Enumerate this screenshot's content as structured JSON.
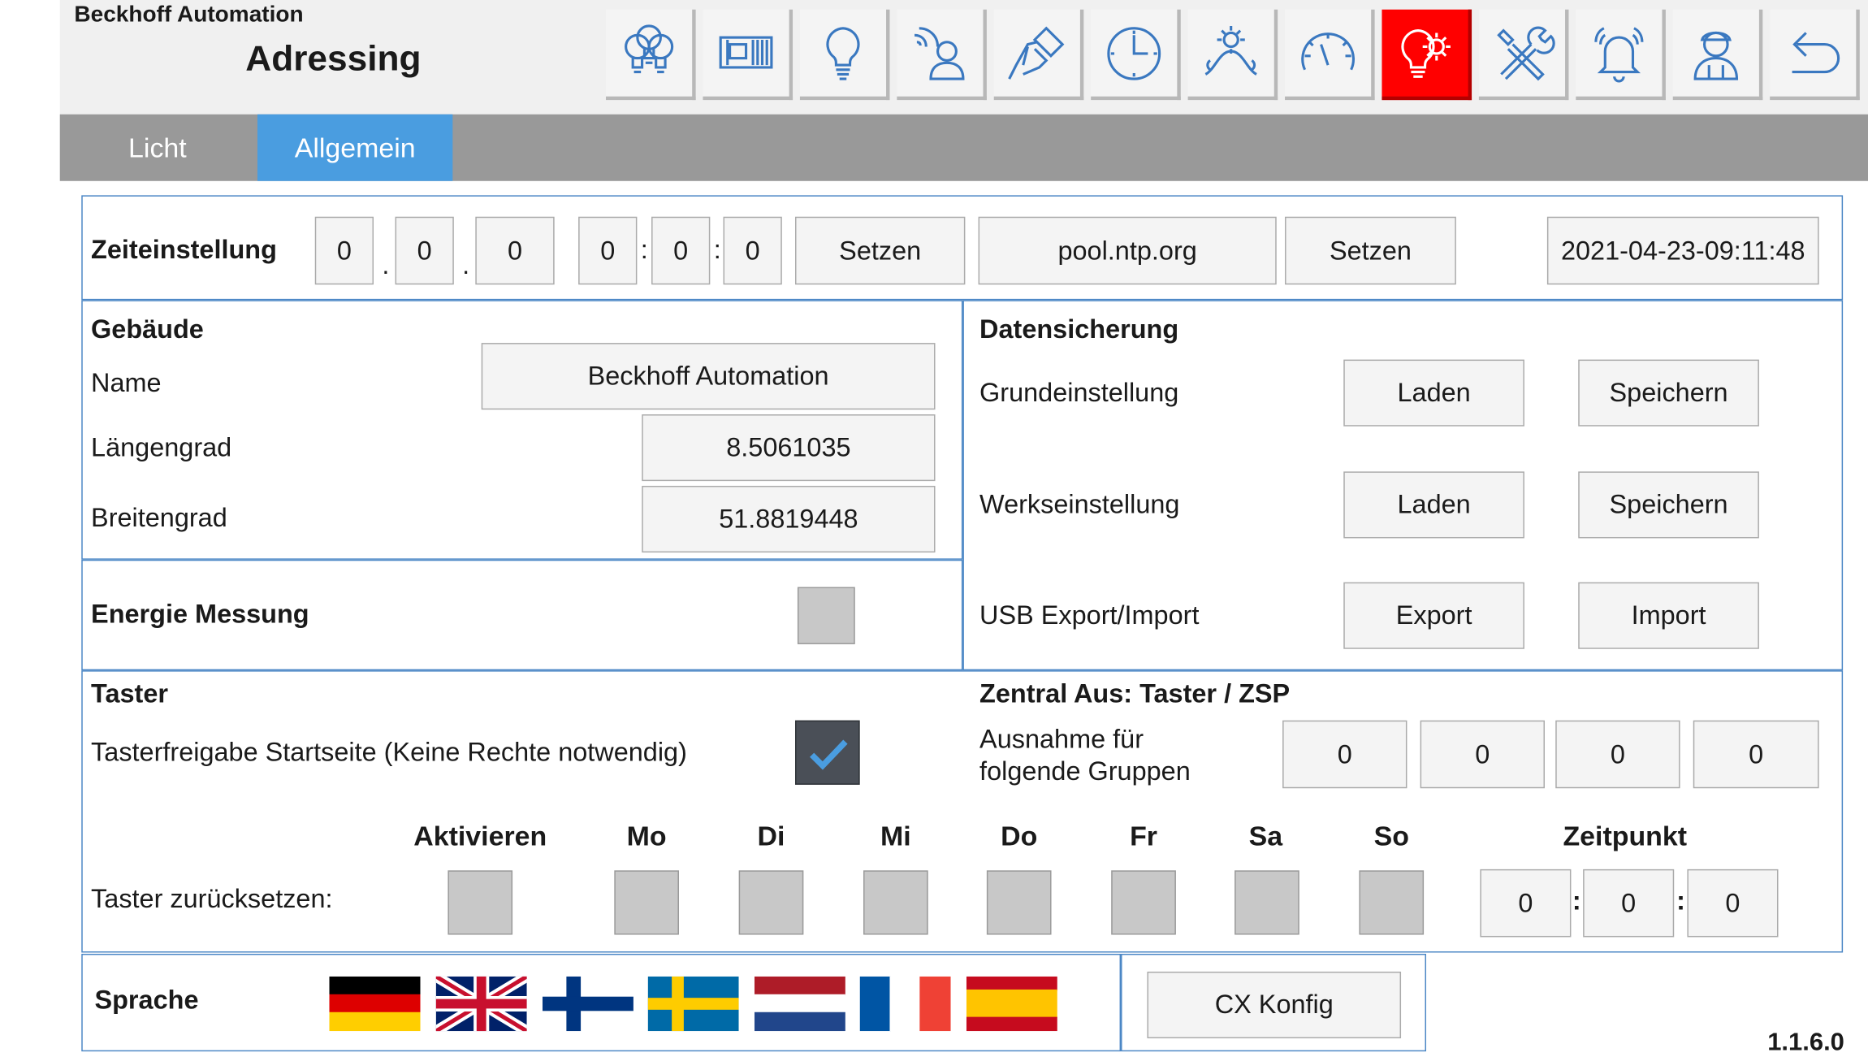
{
  "header": {
    "company": "Beckhoff Automation",
    "page_title": "Adressing",
    "nav": [
      {
        "name": "light-bulbs-icon"
      },
      {
        "name": "blinds-icon"
      },
      {
        "name": "bulb-icon"
      },
      {
        "name": "presence-icon"
      },
      {
        "name": "pushbutton-icon"
      },
      {
        "name": "clock-icon"
      },
      {
        "name": "daylight-icon"
      },
      {
        "name": "gauge-icon"
      },
      {
        "name": "bulb-gear-icon",
        "active": true
      },
      {
        "name": "tools-icon"
      },
      {
        "name": "alarm-bell-icon"
      },
      {
        "name": "user-icon"
      },
      {
        "name": "back-arrow-icon"
      }
    ],
    "active_color": "#ff0000"
  },
  "tabs": [
    {
      "label": "Licht",
      "active": false
    },
    {
      "label": "Allgemein",
      "active": true
    }
  ],
  "time_settings": {
    "label": "Zeiteinstellung",
    "date_fields": [
      "0",
      "0",
      "0"
    ],
    "date_sep": ".",
    "time_fields": [
      "0",
      "0",
      "0"
    ],
    "time_sep": ":",
    "set_label": "Setzen",
    "ntp_server": "pool.ntp.org",
    "ntp_set_label": "Setzen",
    "current_datetime": "2021-04-23-09:11:48"
  },
  "building": {
    "title": "Gebäude",
    "name_label": "Name",
    "name_value": "Beckhoff Automation",
    "longitude_label": "Längengrad",
    "longitude_value": "8.5061035",
    "latitude_label": "Breitengrad",
    "latitude_value": "51.8819448"
  },
  "energy": {
    "label": "Energie Messung",
    "checked": false
  },
  "backup": {
    "title": "Datensicherung",
    "rows": [
      {
        "label": "Grundeinstellung",
        "btn1": "Laden",
        "btn2": "Speichern"
      },
      {
        "label": "Werkseinstellung",
        "btn1": "Laden",
        "btn2": "Speichern"
      },
      {
        "label": "USB Export/Import",
        "btn1": "Export",
        "btn2": "Import"
      }
    ]
  },
  "taster": {
    "title": "Taster",
    "release_label": "Tasterfreigabe Startseite (Keine Rechte notwendig)",
    "release_checked": true,
    "reset_label": "Taster zurücksetzen:",
    "headers": [
      "Aktivieren",
      "Mo",
      "Di",
      "Mi",
      "Do",
      "Fr",
      "Sa",
      "So"
    ],
    "time_header": "Zeitpunkt",
    "time_fields": [
      "0",
      "0",
      "0"
    ],
    "time_sep": ":"
  },
  "central_off": {
    "title": "Zentral Aus: Taster / ZSP",
    "exception_label_1": "Ausnahme für",
    "exception_label_2": "folgende Gruppen",
    "groups": [
      "0",
      "0",
      "0",
      "0"
    ]
  },
  "language": {
    "label": "Sprache",
    "flags": [
      "de-flag-icon",
      "uk-flag-icon",
      "fi-flag-icon",
      "se-flag-icon",
      "nl-flag-icon",
      "fr-flag-icon",
      "es-flag-icon"
    ]
  },
  "cx_config_label": "CX Konfig",
  "version": "1.1.6.0",
  "colors": {
    "tab_active": "#4a9de0",
    "tab_bar": "#999999",
    "panel_border": "#4a86c5",
    "checkbox": "#c8c8c8",
    "checkbox_checked": "#4a4f57"
  }
}
